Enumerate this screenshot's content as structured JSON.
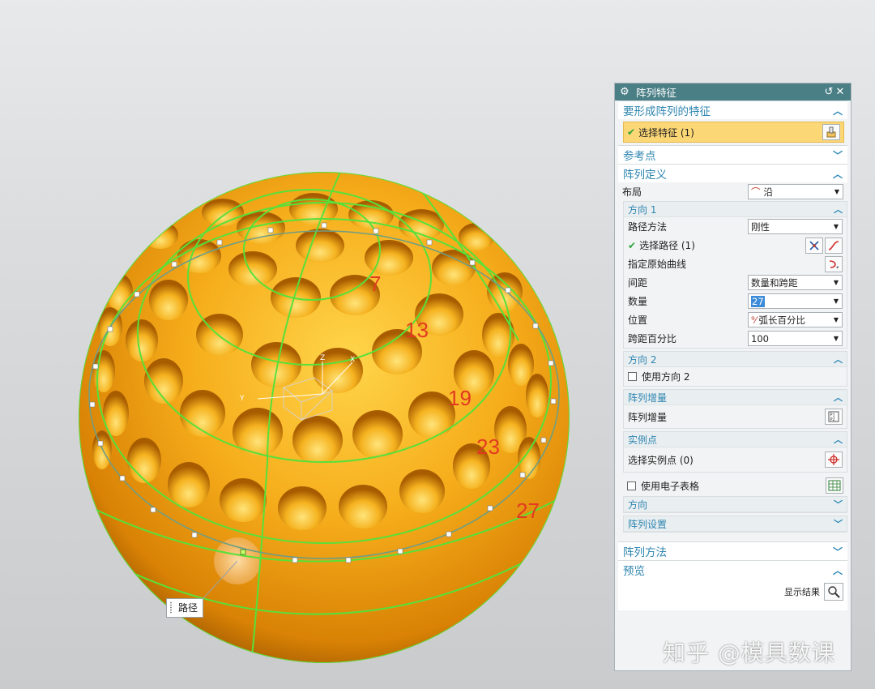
{
  "dialog": {
    "title": "阵列特征",
    "sections": {
      "features": {
        "title": "要形成阵列的特征",
        "select_label": "选择特征 (1)"
      },
      "ref_point": {
        "title": "参考点"
      },
      "definition": {
        "title": "阵列定义",
        "layout_label": "布局",
        "layout_value": "沿",
        "direction1": {
          "title": "方向 1",
          "path_method_label": "路径方法",
          "path_method_value": "刚性",
          "select_path_label": "选择路径 (1)",
          "original_curve_label": "指定原始曲线",
          "spacing_label": "间距",
          "spacing_value": "数量和跨距",
          "count_label": "数量",
          "count_value": "27",
          "position_label": "位置",
          "position_value": "弧长百分比",
          "span_pct_label": "跨距百分比",
          "span_pct_value": "100"
        },
        "direction2": {
          "title": "方向 2",
          "use_label": "使用方向 2"
        },
        "increment": {
          "title": "阵列增量",
          "label": "阵列增量"
        },
        "instance": {
          "title": "实例点",
          "label": "选择实例点 (0)"
        },
        "spreadsheet_label": "使用电子表格",
        "orientation_title": "方向",
        "settings_title": "阵列设置"
      },
      "method": {
        "title": "阵列方法"
      },
      "preview": {
        "title": "预览",
        "show_result_label": "显示结果"
      }
    }
  },
  "viewport": {
    "instance_labels": [
      "7",
      "13",
      "19",
      "23",
      "27"
    ],
    "path_tag": "路径",
    "axis_labels": {
      "z": "Z",
      "y": "Y",
      "x": "X"
    }
  },
  "watermark": "知乎 @模具数课",
  "colors": {
    "titlebar": "#4a7f86",
    "section_title": "#2f86b0",
    "selection_highlight": "#fcd776",
    "sphere": "#f0a316",
    "curve": "#58e03a",
    "label_red": "#e23a22"
  },
  "icons": [
    "gear-icon",
    "reset-icon",
    "close-icon",
    "chevron-up-icon",
    "chevron-down-icon",
    "feature-select-icon",
    "point-dialog-icon",
    "curve-icon",
    "curve-select-icon",
    "increment-icon",
    "crosshair-icon",
    "spreadsheet-icon",
    "magnifier-icon",
    "check-icon"
  ]
}
